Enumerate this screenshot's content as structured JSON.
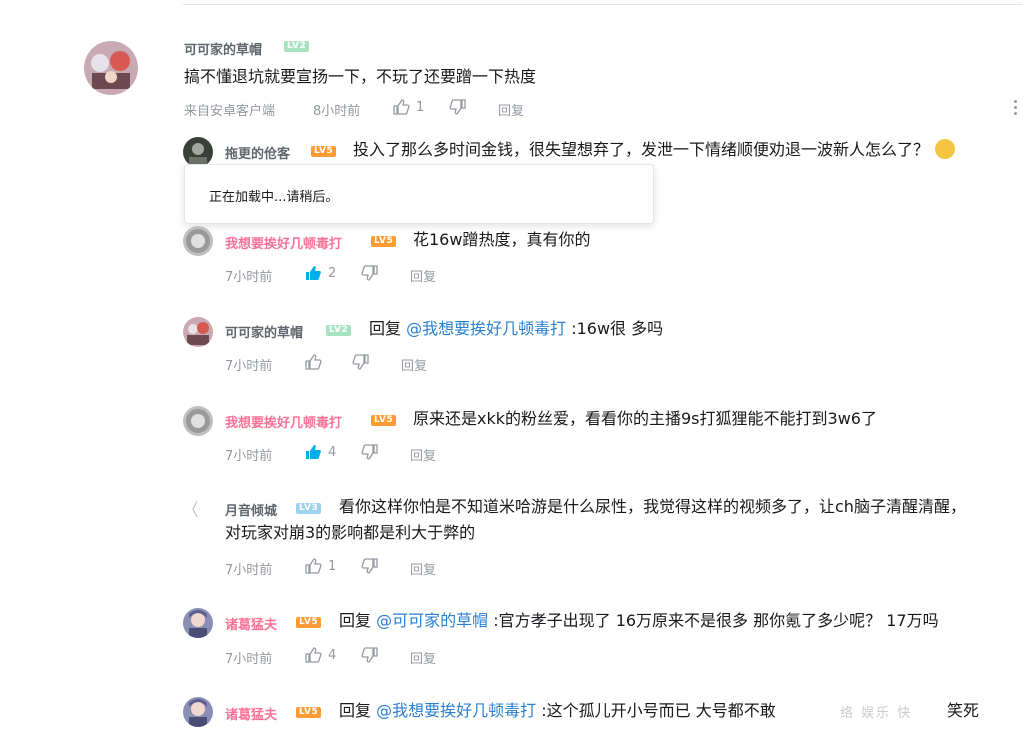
{
  "main_comment": {
    "user": "可可家的草帽",
    "level": "LV2",
    "text": "搞不懂退坑就要宣扬一下，不玩了还要蹭一下热度",
    "source": "来自安卓客户端",
    "time": "8小时前",
    "likes": "1",
    "reply": "回复"
  },
  "replies": [
    {
      "user": "拖更的伧客",
      "level": "LV5",
      "text": "投入了那么多时间金钱，很失望想弃了，发泄一下情绪顺便劝退一波新人怎么了？"
    },
    {
      "user": "我想要挨好几顿毒打",
      "level": "LV5",
      "text": "花16w蹭热度，真有你的",
      "time": "7小时前",
      "likes": "2",
      "reply": "回复"
    },
    {
      "user": "可可家的草帽",
      "level": "LV2",
      "reply_kw": "回复",
      "at": "@我想要挨好几顿毒打",
      "text": ":16w很 多吗",
      "time": "7小时前",
      "reply": "回复"
    },
    {
      "user": "我想要挨好几顿毒打",
      "level": "LV5",
      "text": "原来还是xkk的粉丝爱，看看你的主播9s打狐狸能不能打到3w6了",
      "time": "7小时前",
      "likes": "4",
      "reply": "回复"
    },
    {
      "user": "月音倾城",
      "level": "LV3",
      "text": "看你这样你怕是不知道米哈游是什么尿性，我觉得这样的视频多了，让ch脑子清醒清醒，",
      "text2": "对玩家对崩3的影响都是利大于弊的",
      "time": "7小时前",
      "likes": "1",
      "reply": "回复"
    },
    {
      "user": "诸葛猛夫",
      "level": "LV5",
      "reply_kw": "回复",
      "at": "@可可家的草帽",
      "text": ":官方孝子出现了 16万原来不是很多 那你氪了多少呢？ 17万吗",
      "time": "7小时前",
      "likes": "4",
      "reply": "回复"
    },
    {
      "user": "诸葛猛夫",
      "level": "LV5",
      "reply_kw": "回复",
      "at": "@我想要挨好几顿毒打",
      "text": ":这个孤儿开小号而已 大号都不敢",
      "text_tail": "笑死"
    }
  ],
  "loading_popup": "正在加载中...请稍后。",
  "watermark": "络 娱乐 快",
  "colors": {
    "pink_name": "#fb7299",
    "at_link": "#2b7fd1",
    "meta": "#9499a0",
    "liked": "#00aeec"
  }
}
